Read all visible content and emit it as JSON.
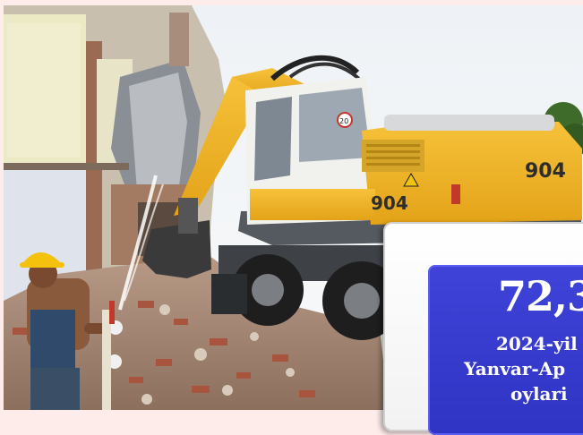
{
  "image": {
    "description_icon": "excavator-demolition-photo"
  },
  "stat_card": {
    "value": "72,3",
    "period_line1": "2024-yil",
    "period_line2": "Yanvar-Ap",
    "period_line3": "oylari",
    "colors": {
      "card_bg": "#ffffff",
      "box_bg": "#3f43d8",
      "text": "#ffffff"
    }
  },
  "excavator": {
    "model_number": "904",
    "cab_badge": "20"
  }
}
